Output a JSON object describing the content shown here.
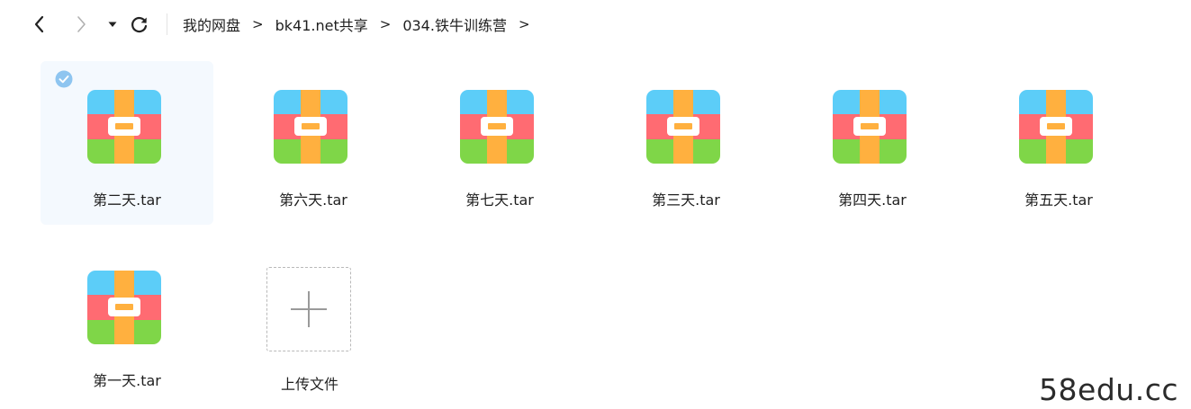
{
  "nav": {
    "back_icon": "chevron-left-icon",
    "forward_icon": "chevron-right-icon",
    "history_icon": "caret-down-icon",
    "refresh_icon": "refresh-icon"
  },
  "breadcrumb": {
    "items": [
      "我的网盘",
      "bk41.net共享",
      "034.铁牛训练营"
    ],
    "separator": ">"
  },
  "files": [
    {
      "name": "第二天.tar",
      "icon": "archive-icon",
      "selected": true
    },
    {
      "name": "第六天.tar",
      "icon": "archive-icon",
      "selected": false
    },
    {
      "name": "第七天.tar",
      "icon": "archive-icon",
      "selected": false
    },
    {
      "name": "第三天.tar",
      "icon": "archive-icon",
      "selected": false
    },
    {
      "name": "第四天.tar",
      "icon": "archive-icon",
      "selected": false
    },
    {
      "name": "第五天.tar",
      "icon": "archive-icon",
      "selected": false
    },
    {
      "name": "第一天.tar",
      "icon": "archive-icon",
      "selected": false
    }
  ],
  "upload": {
    "label": "上传文件",
    "icon": "plus-icon"
  },
  "watermark": "58edu.cc",
  "colors": {
    "archive_top": "#5ccdf8",
    "archive_middle": "#ff6b72",
    "archive_bottom": "#7fd648",
    "archive_strap": "#ffb03f",
    "selected_bg": "#f4f9fe",
    "check_badge": "#8ec5f0"
  }
}
